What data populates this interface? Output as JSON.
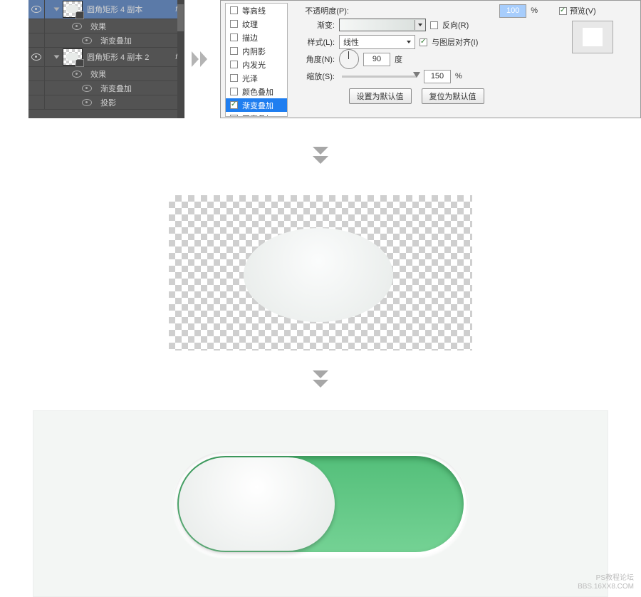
{
  "layers_panel": {
    "rows": [
      {
        "name": "圆角矩形 4 副本",
        "selected": true,
        "fx": "fx"
      },
      {
        "name": "效果"
      },
      {
        "name": "渐变叠加"
      },
      {
        "name": "圆角矩形 4 副本 2",
        "fx": "fx"
      },
      {
        "name": "效果"
      },
      {
        "name": "渐变叠加"
      },
      {
        "name": "投影"
      }
    ]
  },
  "layer_style": {
    "list": [
      {
        "label": "等高线",
        "checked": false
      },
      {
        "label": "纹理",
        "checked": false
      },
      {
        "label": "描边",
        "checked": false
      },
      {
        "label": "内阴影",
        "checked": false
      },
      {
        "label": "内发光",
        "checked": false
      },
      {
        "label": "光泽",
        "checked": false
      },
      {
        "label": "颜色叠加",
        "checked": false
      },
      {
        "label": "渐变叠加",
        "checked": true,
        "selected": true
      },
      {
        "label": "图案叠加",
        "checked": false
      }
    ],
    "opacity_label": "不透明度(P):",
    "opacity_value": "100",
    "percent": "%",
    "gradient_label": "渐变:",
    "reverse": "反向(R)",
    "style_label": "样式(L):",
    "style_value": "线性",
    "align": "与图层对齐(I)",
    "angle_label": "角度(N):",
    "angle_value": "90",
    "degree": "度",
    "scale_label": "缩放(S):",
    "scale_value": "150",
    "btn_default": "设置为默认值",
    "btn_reset": "复位为默认值",
    "preview": "预览(V)"
  },
  "watermark": {
    "l1": "PS教程论坛",
    "l2": "BBS.16XX8.COM"
  }
}
